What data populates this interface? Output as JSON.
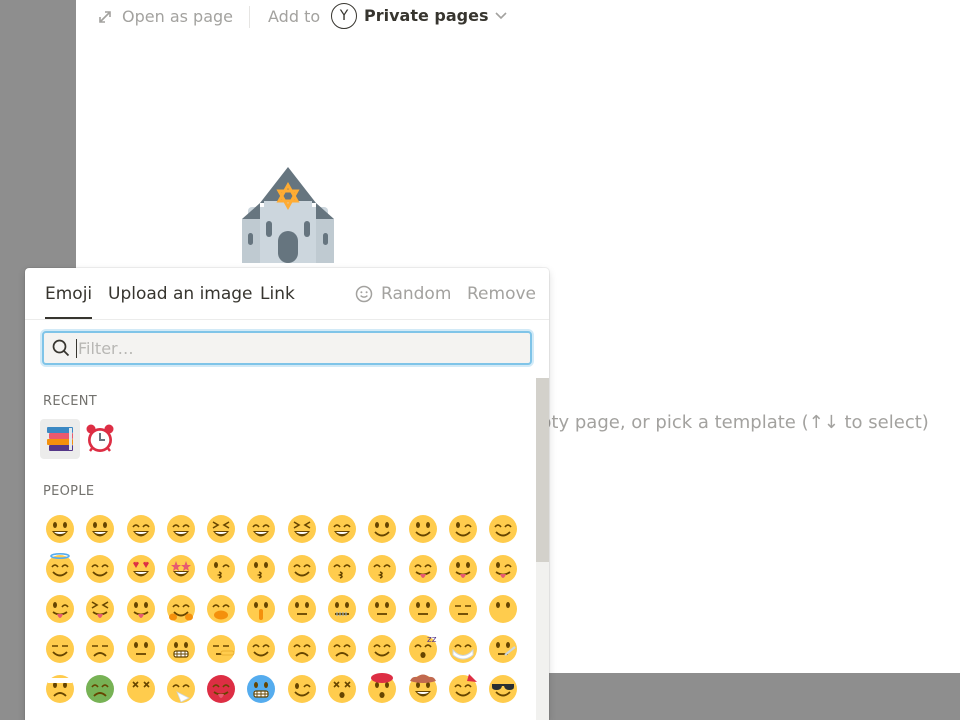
{
  "header": {
    "open_as_page": "Open as page",
    "add_to": "Add to",
    "avatar_letter": "Y",
    "workspace": "Private pages"
  },
  "page": {
    "icon": "synagogue-icon",
    "hint": "pty page, or pick a template (↑↓ to select)"
  },
  "picker": {
    "tabs": {
      "emoji": "Emoji",
      "upload": "Upload an image",
      "link": "Link"
    },
    "random_label": "Random",
    "remove_label": "Remove",
    "filter_placeholder": "Filter…",
    "filter_value": "",
    "recent_label": "RECENT",
    "people_label": "PEOPLE",
    "recent": [
      "books-icon",
      "alarm-clock-icon"
    ],
    "people": [
      [
        "grinning",
        "smiley",
        "smile",
        "grin",
        "laughing",
        "sweat-smile",
        "rofl",
        "joy",
        "slightly-smiling",
        "upside-down",
        "wink",
        "blush"
      ],
      [
        "innocent",
        "smiling-hearts",
        "heart-eyes",
        "star-struck",
        "kissing-heart",
        "kissing",
        "relaxed",
        "kissing-closed-eyes",
        "kissing-smiling-eyes",
        "yum",
        "tongue",
        "winking-tongue"
      ],
      [
        "zany",
        "squinting-tongue",
        "money-mouth",
        "hugging",
        "hand-over-mouth",
        "shushing",
        "thinking",
        "zipper-mouth",
        "raised-eyebrow",
        "neutral",
        "expressionless",
        "no-mouth"
      ],
      [
        "smirk",
        "unamused",
        "rolling-eyes",
        "grimacing",
        "lying",
        "relieved",
        "pensive",
        "sleepy",
        "drooling",
        "sleeping",
        "mask",
        "thermometer"
      ],
      [
        "head-bandage",
        "nauseated",
        "vomiting",
        "sneezing",
        "hot",
        "cold",
        "woozy",
        "dizzy",
        "exploding-head",
        "cowboy",
        "partying",
        "sunglasses"
      ]
    ],
    "colors": {
      "accent_focus": "#7fc4e8",
      "emoji_yellow": "#ffcc4d",
      "text": "#37352f",
      "muted": "#a3a29f"
    }
  }
}
